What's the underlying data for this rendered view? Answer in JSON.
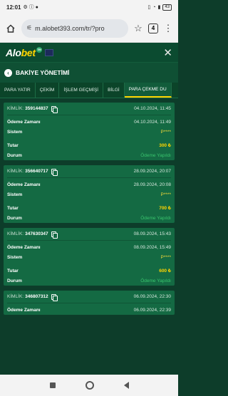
{
  "status": {
    "time": "12:01",
    "battery": "43"
  },
  "browser": {
    "url": "m.alobet393.com/tr/?pro",
    "tab_count": "4"
  },
  "site": {
    "logo_main": "Alo",
    "logo_accent": "bet",
    "logo_badge": "TM"
  },
  "section": {
    "title": "BAKİYE YÖNETİMİ"
  },
  "tabs": [
    "PARA YATIR",
    "ÇEKİM",
    "İŞLEM GEÇMİŞİ",
    "BİLGİ",
    "PARA ÇEKME DU"
  ],
  "labels": {
    "kimlik": "KİMLİK:",
    "odeme_zamani": "Ödeme Zamanı",
    "sistem": "Sistem",
    "tutar": "Tutar",
    "durum": "Durum"
  },
  "transactions": [
    {
      "id": "359144837",
      "date": "04.10.2024, 11:45",
      "payment_time": "04.10.2024, 11:49",
      "system": "P****",
      "amount": "300 ₺",
      "status": "Ödeme Yapıldı"
    },
    {
      "id": "356640717",
      "date": "28.09.2024, 20:07",
      "payment_time": "28.09.2024, 20:08",
      "system": "P****",
      "amount": "700 ₺",
      "status": "Ödeme Yapıldı"
    },
    {
      "id": "347630347",
      "date": "08.09.2024, 15:43",
      "payment_time": "08.09.2024, 15:49",
      "system": "P****",
      "amount": "600 ₺",
      "status": "Ödeme Yapıldı"
    },
    {
      "id": "346807312",
      "date": "06.09.2024, 22:30",
      "payment_time": "06.09.2024, 22:39"
    }
  ]
}
